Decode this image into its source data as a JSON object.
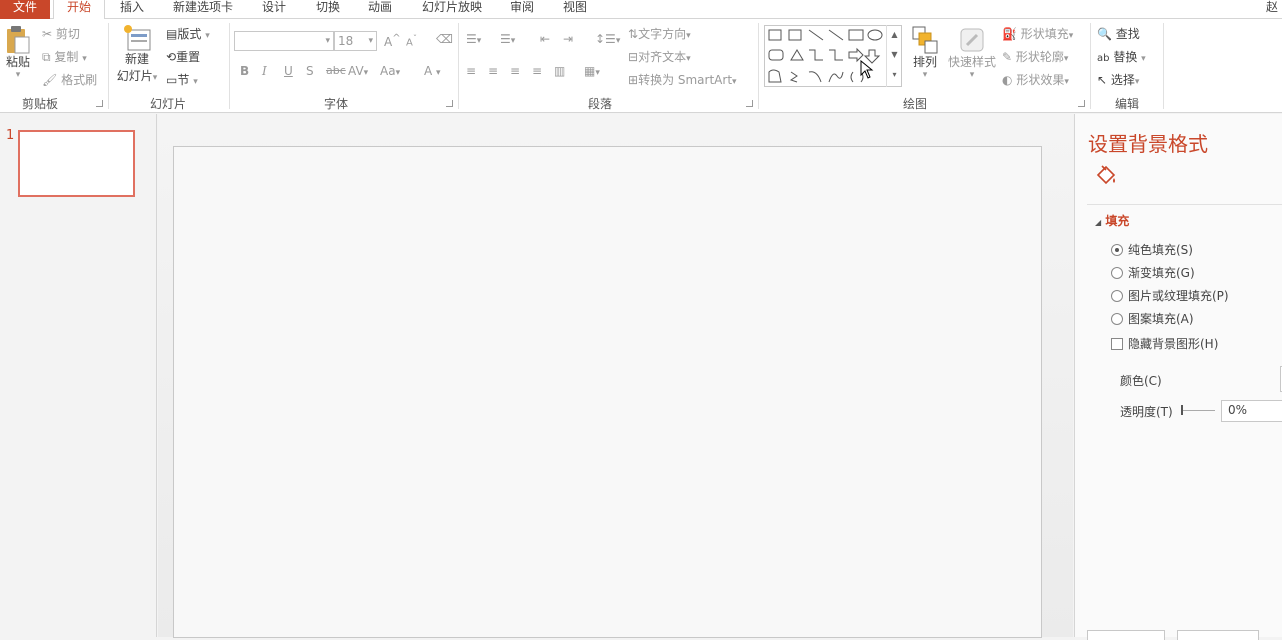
{
  "tabs": {
    "file": "文件",
    "home": "开始",
    "insert": "插入",
    "new_tab": "新建选项卡",
    "design": "设计",
    "transitions": "切换",
    "animations": "动画",
    "slideshow": "幻灯片放映",
    "review": "审阅",
    "view": "视图",
    "user": "赵"
  },
  "clipboard": {
    "paste": "粘贴",
    "cut": "剪切",
    "copy": "复制",
    "format_painter": "格式刷",
    "label": "剪贴板"
  },
  "slides": {
    "new_slide_line1": "新建",
    "new_slide_line2": "幻灯片",
    "layout": "版式",
    "reset": "重置",
    "section": "节",
    "label": "幻灯片"
  },
  "font": {
    "size": "18",
    "bold": "B",
    "italic": "I",
    "underline": "U",
    "shadow": "S",
    "strike": "abc",
    "spacing": "AV",
    "case": "Aa",
    "color": "A",
    "grow": "A",
    "shrink": "A",
    "label": "字体"
  },
  "paragraph": {
    "text_direction": "文字方向",
    "align_text": "对齐文本",
    "smartart": "转换为 SmartArt",
    "label": "段落"
  },
  "drawing": {
    "arrange": "排列",
    "quick_styles": "快速样式",
    "shape_fill": "形状填充",
    "shape_outline": "形状轮廓",
    "shape_effects": "形状效果",
    "label": "绘图"
  },
  "editing": {
    "find": "查找",
    "replace": "替换",
    "select": "选择",
    "label": "编辑"
  },
  "thumbs": {
    "slide_number": "1"
  },
  "format_pane": {
    "title": "设置背景格式",
    "fill_section": "填充",
    "solid_fill": "纯色填充(S)",
    "gradient_fill": "渐变填充(G)",
    "picture_fill": "图片或纹理填充(P)",
    "pattern_fill": "图案填充(A)",
    "hide_bg": "隐藏背景图形(H)",
    "color_label": "颜色(C)",
    "transparency_label": "透明度(T)",
    "transparency_value": "0%"
  },
  "colors": {
    "accent": "#c9472a",
    "thumb_border": "#e07060"
  }
}
